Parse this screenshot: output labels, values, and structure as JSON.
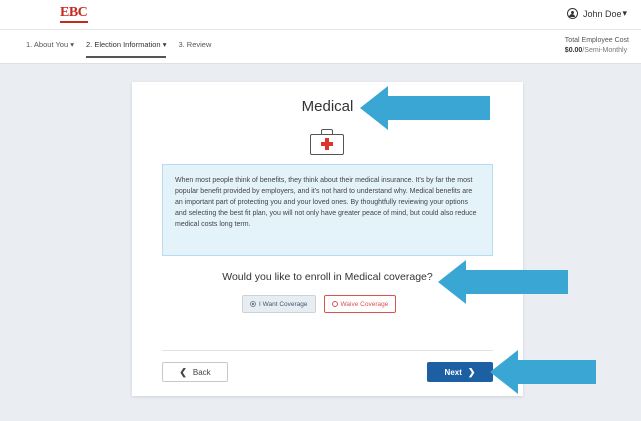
{
  "header": {
    "logo_text": "EBC",
    "user_name": "John Doe",
    "user_caret": "▾"
  },
  "steps": [
    {
      "label": "1. About You ▾"
    },
    {
      "label": "2. Election Information ▾"
    },
    {
      "label": "3. Review"
    }
  ],
  "cost": {
    "label": "Total Employee Cost",
    "amount": "$0.00",
    "period": "/Semi-Monthly"
  },
  "card": {
    "title": "Medical",
    "icon": "medical-kit-icon",
    "info_text": "When most people think of benefits, they think about their medical insurance. It's by far the most popular benefit provided by employers, and it's not hard to understand why. Medical benefits are an important part of protecting you and your loved ones. By thoughtfully reviewing your options and selecting the best fit plan, you will not only have greater peace of mind, but could also reduce medical costs long term.",
    "question": "Would you like to enroll in Medical coverage?",
    "choice_want": "I Want Coverage",
    "choice_waive": "Waive Coverage",
    "back_label": "Back",
    "next_label": "Next"
  },
  "colors": {
    "brand_red": "#c8281e",
    "primary_blue": "#1d5fa3",
    "arrow_blue": "#3aa6d3",
    "info_bg": "#e4f2fa"
  }
}
